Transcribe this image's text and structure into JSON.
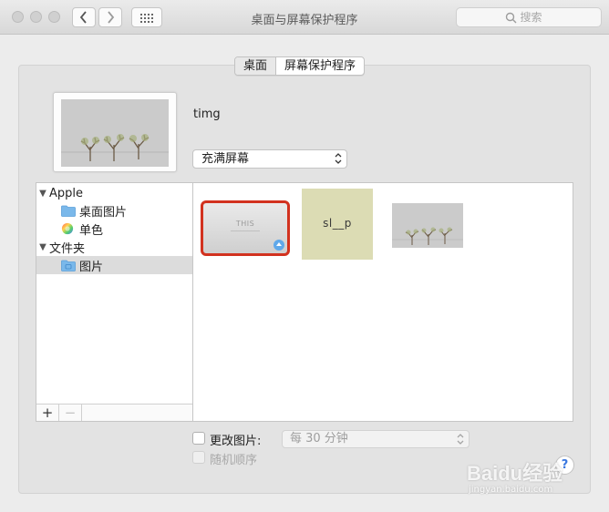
{
  "window": {
    "title": "桌面与屏幕保护程序",
    "search_placeholder": "搜索"
  },
  "tabs": [
    {
      "label": "桌面",
      "active": true
    },
    {
      "label": "屏幕保护程序",
      "active": false
    }
  ],
  "current": {
    "image_name": "timg",
    "fill_mode": "充满屏幕"
  },
  "sidebar": {
    "groups": [
      {
        "label": "Apple",
        "expanded": true,
        "items": [
          {
            "label": "桌面图片",
            "icon": "folder-icon"
          },
          {
            "label": "单色",
            "icon": "color-wheel-icon"
          }
        ]
      },
      {
        "label": "文件夹",
        "expanded": true,
        "items": [
          {
            "label": "图片",
            "icon": "folder-icon",
            "selected": true
          }
        ]
      }
    ],
    "add_label": "+",
    "remove_label": "−"
  },
  "thumbnails": [
    {
      "name": "this-wallpaper",
      "text": "THIS",
      "selected": true
    },
    {
      "name": "sleep-wallpaper",
      "text": "sl__p",
      "selected": false
    },
    {
      "name": "trees-wallpaper",
      "text": "",
      "selected": false
    }
  ],
  "options": {
    "change_picture_label": "更改图片:",
    "change_picture_checked": false,
    "interval": "每 30 分钟",
    "random_label": "随机顺序",
    "random_checked": false,
    "help_label": "?"
  },
  "watermark": {
    "brand": "Baidu经验",
    "url": "jingyan.baidu.com"
  },
  "colors": {
    "selection_ring": "#d2321f",
    "accent": "#3a78e0",
    "sleep_bg": "#dcdcb4"
  }
}
